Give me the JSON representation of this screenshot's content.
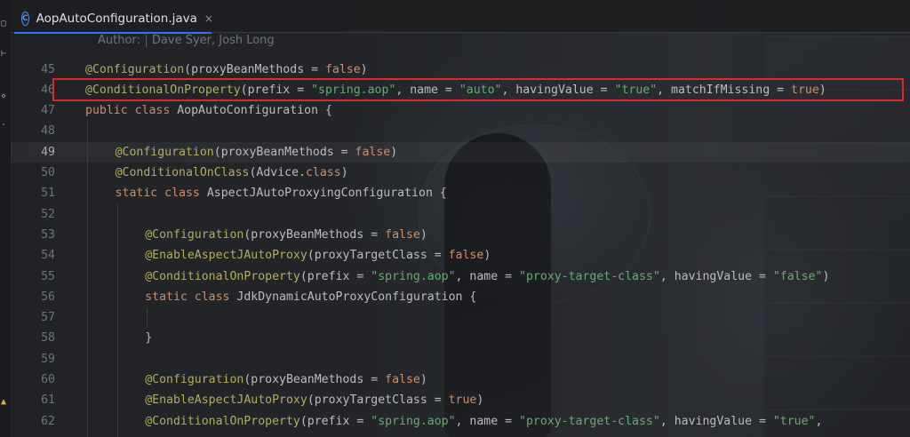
{
  "editor": {
    "tab": {
      "icon": "C",
      "file_name": "AopAutoConfiguration.java",
      "close_glyph": "×"
    },
    "author_label": "Author:",
    "author_value": "Dave Syer, Josh Long",
    "current_line": "49",
    "highlighted_line": "46",
    "highlight_color": "#e0272a",
    "lines": [
      {
        "n": "45",
        "indent": 0,
        "tokens": [
          [
            "ann",
            "@Configuration"
          ],
          [
            "plain",
            "(proxyBeanMethods = "
          ],
          [
            "kw",
            "false"
          ],
          [
            "plain",
            ")"
          ]
        ]
      },
      {
        "n": "46",
        "indent": 0,
        "tokens": [
          [
            "ann",
            "@ConditionalOnProperty"
          ],
          [
            "plain",
            "(prefix = "
          ],
          [
            "str",
            "\"spring.aop\""
          ],
          [
            "plain",
            ", name = "
          ],
          [
            "str",
            "\"auto\""
          ],
          [
            "plain",
            ", havingValue = "
          ],
          [
            "str",
            "\"true\""
          ],
          [
            "plain",
            ", matchIfMissing = "
          ],
          [
            "kw",
            "true"
          ],
          [
            "plain",
            ")"
          ]
        ]
      },
      {
        "n": "47",
        "indent": 0,
        "tokens": [
          [
            "kw",
            "public class "
          ],
          [
            "plain",
            "AopAutoConfiguration {"
          ]
        ]
      },
      {
        "n": "48",
        "indent": 0,
        "tokens": []
      },
      {
        "n": "49",
        "indent": 1,
        "tokens": [
          [
            "ann",
            "@Configuration"
          ],
          [
            "plain",
            "(proxyBeanMethods = "
          ],
          [
            "kw",
            "false"
          ],
          [
            "plain",
            ")"
          ]
        ]
      },
      {
        "n": "50",
        "indent": 1,
        "tokens": [
          [
            "ann",
            "@ConditionalOnClass"
          ],
          [
            "plain",
            "(Advice."
          ],
          [
            "kw",
            "class"
          ],
          [
            "plain",
            ")"
          ]
        ]
      },
      {
        "n": "51",
        "indent": 1,
        "tokens": [
          [
            "kw",
            "static class "
          ],
          [
            "plain",
            "AspectJAutoProxyingConfiguration {"
          ]
        ]
      },
      {
        "n": "52",
        "indent": 0,
        "tokens": []
      },
      {
        "n": "53",
        "indent": 2,
        "tokens": [
          [
            "ann",
            "@Configuration"
          ],
          [
            "plain",
            "(proxyBeanMethods = "
          ],
          [
            "kw",
            "false"
          ],
          [
            "plain",
            ")"
          ]
        ]
      },
      {
        "n": "54",
        "indent": 2,
        "tokens": [
          [
            "ann",
            "@EnableAspectJAutoProxy"
          ],
          [
            "plain",
            "(proxyTargetClass = "
          ],
          [
            "kw",
            "false"
          ],
          [
            "plain",
            ")"
          ]
        ]
      },
      {
        "n": "55",
        "indent": 2,
        "tokens": [
          [
            "ann",
            "@ConditionalOnProperty"
          ],
          [
            "plain",
            "(prefix = "
          ],
          [
            "str",
            "\"spring.aop\""
          ],
          [
            "plain",
            ", name = "
          ],
          [
            "str",
            "\"proxy-target-class\""
          ],
          [
            "plain",
            ", havingValue = "
          ],
          [
            "str",
            "\"false\""
          ],
          [
            "plain",
            ")"
          ]
        ]
      },
      {
        "n": "56",
        "indent": 2,
        "tokens": [
          [
            "kw",
            "static class "
          ],
          [
            "plain",
            "JdkDynamicAutoProxyConfiguration {"
          ]
        ]
      },
      {
        "n": "57",
        "indent": 0,
        "tokens": []
      },
      {
        "n": "58",
        "indent": 2,
        "tokens": [
          [
            "plain",
            "}"
          ]
        ]
      },
      {
        "n": "59",
        "indent": 0,
        "tokens": []
      },
      {
        "n": "60",
        "indent": 2,
        "tokens": [
          [
            "ann",
            "@Configuration"
          ],
          [
            "plain",
            "(proxyBeanMethods = "
          ],
          [
            "kw",
            "false"
          ],
          [
            "plain",
            ")"
          ]
        ]
      },
      {
        "n": "61",
        "indent": 2,
        "tokens": [
          [
            "ann",
            "@EnableAspectJAutoProxy"
          ],
          [
            "plain",
            "(proxyTargetClass = "
          ],
          [
            "kw",
            "true"
          ],
          [
            "plain",
            ")"
          ]
        ]
      },
      {
        "n": "62",
        "indent": 2,
        "tokens": [
          [
            "ann",
            "@ConditionalOnProperty"
          ],
          [
            "plain",
            "(prefix = "
          ],
          [
            "str",
            "\"spring.aop\""
          ],
          [
            "plain",
            ", name = "
          ],
          [
            "str",
            "\"proxy-target-class\""
          ],
          [
            "plain",
            ", havingValue = "
          ],
          [
            "str",
            "\"true\""
          ],
          [
            "plain",
            ","
          ]
        ]
      }
    ]
  },
  "toolstrip": {
    "icons": [
      "folder-icon",
      "commit-icon",
      "structure-icon",
      "more-icon",
      "notification-icon"
    ]
  }
}
